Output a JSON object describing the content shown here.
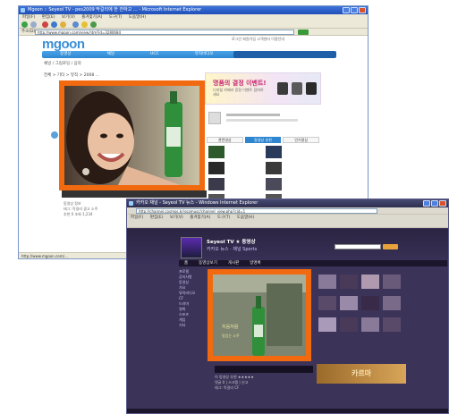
{
  "window1": {
    "title": "Mgoon :: Seyeol TV - pes2009 막걸리에 한 잔하고 ... - Microsoft Internet Explorer",
    "menu": [
      "파일(F)",
      "편집(E)",
      "보기(V)",
      "즐겨찾기(A)",
      "도구(T)",
      "도움말(H)"
    ],
    "address_label": "주소(D)",
    "url": "http://www.mgoon.com/view.htm?id=3280684",
    "status": "http://www.mgoon.com/..."
  },
  "mgoon": {
    "logo": "mgoon",
    "nav": [
      "동영상",
      "채널",
      "UCC",
      "뮤직비디오",
      "뉴스"
    ],
    "top_links": "로그인  회원가입  고객센터  이용안내",
    "sub": "채널 / 그림로딩 / 음악",
    "breadcrumb": "전체 > 기타 > 뮤직 > 2008 ...",
    "banner_title": "명품의 결정 이벤트!",
    "banner_text": "디지털 카메라 증정 이벤트 참여하세요",
    "tabs": [
      "관련영상",
      "동영상 추천",
      "인기영상"
    ],
    "bottom_lines": [
      "동영상 정보",
      "태그: 막걸리 광고 소주",
      "추천 0  조회 1,234"
    ]
  },
  "window2": {
    "title": "카카오 채널 - Seyeol TV 뉴스 - Windows Internet Explorer",
    "url": "http://channel.cosmos.kr/ssamusc/channel_view.php?cid=1",
    "site_title": "Seyeol TV ★  동영상",
    "site_sub": "카카오 뉴스 · 채널 Sports",
    "nav": [
      "홈",
      "동영상보기",
      "게시판",
      "방명록"
    ],
    "left_menu": [
      "프로필",
      "공지사항",
      "동영상",
      "가요",
      "뮤직비디오",
      "CF",
      "드라마",
      "영화",
      "스포츠",
      "게임",
      "기타"
    ],
    "banner": "카르마",
    "rows": [
      "이 동영상 추천 ★★★★★",
      "댓글 0  |  스크랩  |  신고",
      "태그: 막걸리 CF"
    ]
  },
  "colors": {
    "highlight": "#f26a10",
    "mgoon_blue": "#2f86d0",
    "dark_bg": "#3b3358"
  }
}
